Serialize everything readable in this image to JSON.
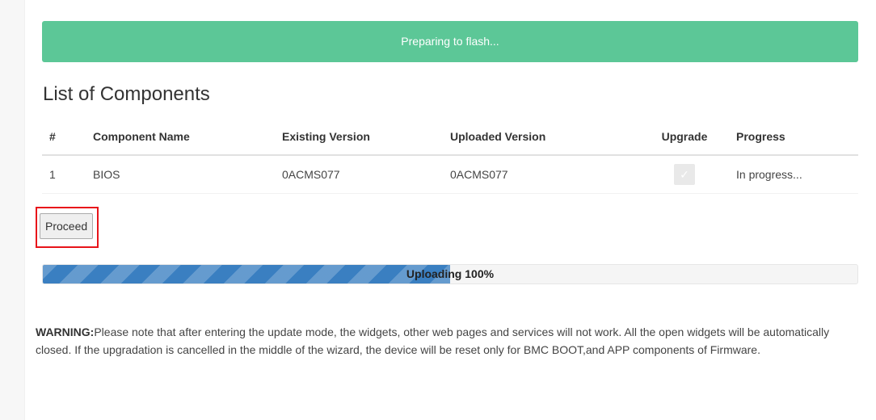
{
  "status_banner": "Preparing to flash...",
  "section_title": "List of Components",
  "table": {
    "columns": [
      "#",
      "Component Name",
      "Existing Version",
      "Uploaded Version",
      "Upgrade",
      "Progress"
    ],
    "rows": [
      {
        "num": "1",
        "name": "BIOS",
        "existing_version": "0ACMS077",
        "uploaded_version": "0ACMS077",
        "upgrade_checked": true,
        "upgrade_enabled": false,
        "progress": "In progress..."
      }
    ]
  },
  "proceed_label": "Proceed",
  "upload": {
    "label": "Uploading 100%",
    "fill_fraction": 0.5
  },
  "warning": {
    "prefix": "WARNING:",
    "text": "Please note that after entering the update mode, the widgets, other web pages and services will not work. All the open widgets will be automatically closed. If the upgradation is cancelled in the middle of the wizard, the device will be reset only for BMC BOOT,and APP components of Firmware."
  },
  "colors": {
    "banner": "#5cc797",
    "progress_fill": "#3a7fc1",
    "highlight": "#e8141a"
  }
}
